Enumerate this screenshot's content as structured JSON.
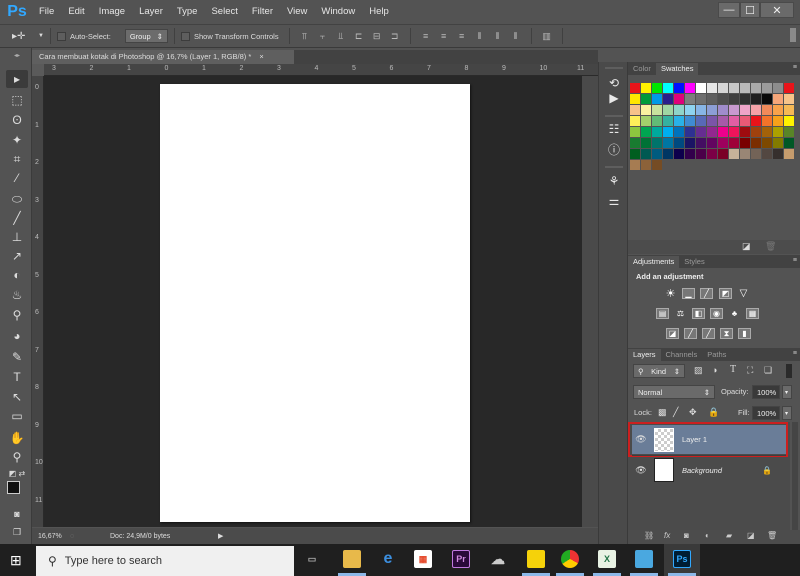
{
  "app": {
    "logo": "Ps"
  },
  "menu": [
    "File",
    "Edit",
    "Image",
    "Layer",
    "Type",
    "Select",
    "Filter",
    "View",
    "Window",
    "Help"
  ],
  "window_controls": {
    "minimize": "—",
    "maximize": "☐",
    "close": "✕"
  },
  "options": {
    "tool_glyph": "▸✛",
    "auto_select_label": "Auto-Select:",
    "auto_select_checked": false,
    "group_value": "Group",
    "show_transform_label": "Show Transform Controls",
    "show_transform_checked": false
  },
  "document": {
    "tab_title": "Cara membuat kotak di Photoshop @ 16,7% (Layer 1, RGB/8) *",
    "close": "×",
    "h_ruler": [
      "3",
      "2",
      "1",
      "0",
      "1",
      "2",
      "3",
      "4",
      "5",
      "6",
      "7",
      "8",
      "9",
      "10",
      "11"
    ],
    "v_ruler": [
      "0",
      "1",
      "2",
      "3",
      "4",
      "5",
      "6",
      "7",
      "8",
      "9",
      "10",
      "11"
    ]
  },
  "status": {
    "zoom": "16,67%",
    "doc": "Doc: 24,9M/0 bytes",
    "arrow": "▶"
  },
  "swatches_panel": {
    "tabs": [
      "Color",
      "Swatches"
    ],
    "active": "Swatches",
    "colors": [
      "#e8141a",
      "#fff200",
      "#00e600",
      "#00ffff",
      "#0010ff",
      "#ff00ff",
      "#ffffff",
      "#e6e6e6",
      "#d6d6d6",
      "#c8c8c8",
      "#b9b9b9",
      "#aaaaaa",
      "#9b9b9b",
      "#8c8c8c",
      "#e8141a",
      "#ffe600",
      "#009a3a",
      "#0099e6",
      "#2a1f8c",
      "#e0007a",
      "#7d7d7d",
      "#6e6e6e",
      "#5e5e5e",
      "#4f4f4f",
      "#404040",
      "#303030",
      "#1f1f1f",
      "#0a0a0a",
      "#f5a679",
      "#f7c48a",
      "#f7c28a",
      "#fbf1a0",
      "#c8e29e",
      "#a0d6a4",
      "#8fd4c9",
      "#8ed3ef",
      "#87b5e6",
      "#8c9ed6",
      "#a08ccc",
      "#c99ad0",
      "#eea4c8",
      "#f4a2a8",
      "#f08a5a",
      "#f7a24b",
      "#f6b955",
      "#ffef5a",
      "#a3d06c",
      "#62bb77",
      "#35b1a1",
      "#2ab1e7",
      "#3f8bd2",
      "#5869b7",
      "#7b55a8",
      "#a75aa8",
      "#e15ea4",
      "#e95a76",
      "#e8141a",
      "#f2732a",
      "#f7a11a",
      "#fff200",
      "#8dc63f",
      "#00a651",
      "#00a99d",
      "#00aeef",
      "#0072bc",
      "#2e3192",
      "#662d91",
      "#92278f",
      "#ec008c",
      "#ed145b",
      "#9e0b0f",
      "#a0410d",
      "#a36209",
      "#aba000",
      "#598527",
      "#197b30",
      "#007236",
      "#00746b",
      "#0076a3",
      "#004a80",
      "#1b1464",
      "#440e62",
      "#630460",
      "#9e005d",
      "#9e0039",
      "#790000",
      "#7b2e00",
      "#7d4900",
      "#827b00",
      "#005826",
      "#005e20",
      "#005952",
      "#005b7f",
      "#003663",
      "#0d004c",
      "#32004b",
      "#4b0049",
      "#7b0046",
      "#7a0026",
      "#c7b299",
      "#998675",
      "#736357",
      "#534741",
      "#362f2d",
      "#c69c6d",
      "#a67c52",
      "#8c6239",
      "#754c24"
    ]
  },
  "adjustments_panel": {
    "tabs": [
      "Adjustments",
      "Styles"
    ],
    "active": "Adjustments",
    "heading": "Add an adjustment",
    "icons_row1": [
      "brightness-contrast",
      "levels",
      "curves",
      "exposure",
      "vibrance"
    ],
    "icons_row2": [
      "hue-saturation",
      "color-balance",
      "black-white",
      "photo-filter",
      "channel-mixer",
      "color-lookup"
    ],
    "icons_row3": [
      "invert",
      "posterize",
      "threshold",
      "selective-color",
      "gradient-map"
    ]
  },
  "layers_panel": {
    "tabs": [
      "Layers",
      "Channels",
      "Paths"
    ],
    "active": "Layers",
    "filter_kind": "Kind",
    "blend_mode": "Normal",
    "opacity_label": "Opacity:",
    "opacity_value": "100%",
    "lock_label": "Lock:",
    "fill_label": "Fill:",
    "fill_value": "100%",
    "layers": [
      {
        "name": "Layer 1",
        "visible": true,
        "selected": true,
        "locked": false
      },
      {
        "name": "Background",
        "visible": true,
        "selected": false,
        "locked": true
      }
    ],
    "highlight_color": "#cc1f1f"
  },
  "taskbar": {
    "search_placeholder": "Type here to search",
    "apps": [
      {
        "name": "task-view",
        "glyph": "▭"
      },
      {
        "name": "file-explorer",
        "glyph": "▬"
      },
      {
        "name": "edge",
        "glyph": "e"
      },
      {
        "name": "store",
        "glyph": "▦"
      },
      {
        "name": "premiere",
        "glyph": "Pr"
      },
      {
        "name": "app-cloud",
        "glyph": "☁"
      },
      {
        "name": "sticky-notes",
        "glyph": "▪"
      },
      {
        "name": "chrome",
        "glyph": "●"
      },
      {
        "name": "excel",
        "glyph": "X"
      },
      {
        "name": "app-blue",
        "glyph": "▬"
      },
      {
        "name": "photoshop",
        "glyph": "Ps"
      }
    ]
  }
}
